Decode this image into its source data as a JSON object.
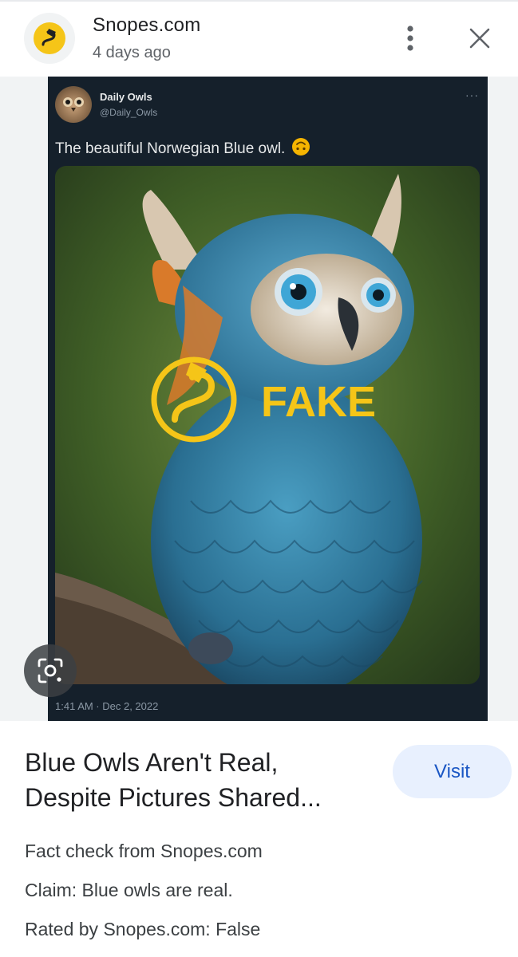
{
  "header": {
    "site_name": "Snopes.com",
    "post_age": "4 days ago",
    "logo_icon": "snopes-logo-icon",
    "more_icon": "more-vert-icon",
    "close_icon": "close-icon"
  },
  "image": {
    "tweet": {
      "author_name": "Daily Owls",
      "author_handle": "@Daily_Owls",
      "more_label": "···",
      "text": "The beautiful Norwegian Blue owl.",
      "emoji_icon": "upside-down-smile-icon",
      "timestamp": "1:41 AM · Dec 2, 2022"
    },
    "stamp_label": "FAKE",
    "lens_icon": "google-lens-icon"
  },
  "result": {
    "title": "Blue Owls Aren't Real,\nDespite Pictures Shared...",
    "visit_label": "Visit",
    "source_line": "Fact check from Snopes.com",
    "claim_line": "Claim: Blue owls are real.",
    "rating_line": "Rated by Snopes.com: False"
  },
  "colors": {
    "snopes_yellow": "#f5c518",
    "visit_bg": "#e8f0fe",
    "visit_text": "#1a56c4",
    "tweet_bg": "#15202b"
  }
}
